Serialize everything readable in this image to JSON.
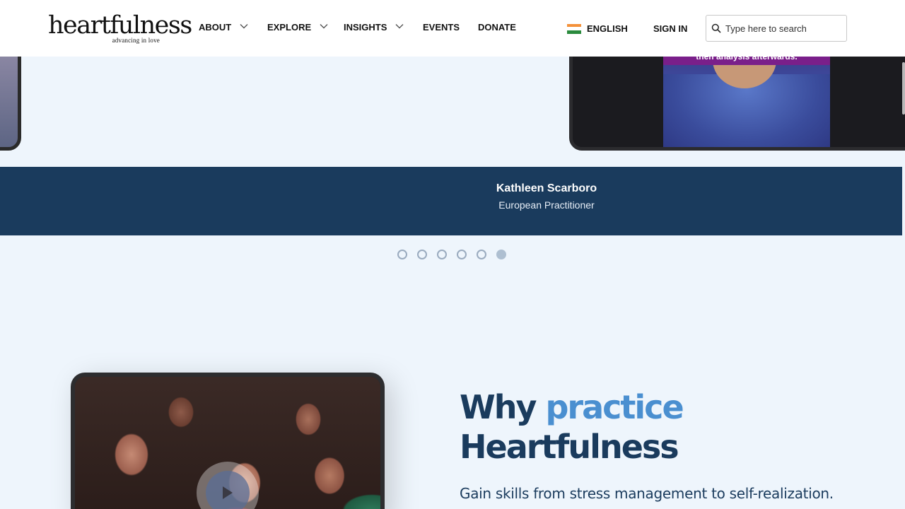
{
  "brand": {
    "logo_text": "heartfulness",
    "tagline": "advancing in love"
  },
  "nav": {
    "items": [
      {
        "label": "ABOUT",
        "has_dropdown": true
      },
      {
        "label": "EXPLORE",
        "has_dropdown": true
      },
      {
        "label": "INSIGHTS",
        "has_dropdown": true
      },
      {
        "label": "EVENTS",
        "has_dropdown": false
      },
      {
        "label": "DONATE",
        "has_dropdown": false
      }
    ],
    "language": "ENGLISH",
    "sign_in": "SIGN IN",
    "search_placeholder": "Type here to search"
  },
  "testimonial": {
    "video_caption": "then analysis afterwards.",
    "name": "Kathleen Scarboro",
    "role": "European Practitioner",
    "dots_count": 6,
    "active_dot_index": 5
  },
  "why_section": {
    "title_part1": "Why ",
    "title_accent": "practice",
    "title_part2": "Heartfulness",
    "subtitle": "Gain skills from stress management to self-realization."
  },
  "colors": {
    "navy": "#1a3b5d",
    "accent_blue": "#4a8fd0",
    "page_bg": "#eef5fc"
  }
}
